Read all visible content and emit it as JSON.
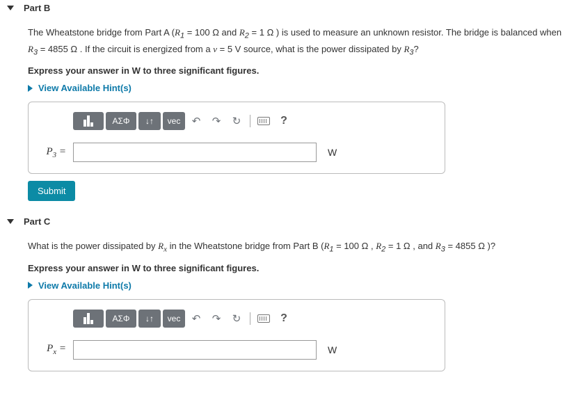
{
  "parts": {
    "b": {
      "title": "Part B",
      "prompt_html": "The Wheatstone bridge from Part A (<span class='ital'>R</span><span class='sub'>1</span> = 100  Ω and <span class='ital'>R</span><span class='sub'>2</span> = 1  Ω ) is used to measure an unknown resistor. The bridge is balanced when <span class='ital'>R</span><span class='sub'>3</span> = 4855  Ω . If the circuit is energized from a <span class='ital'>v</span> = 5  V  source, what is the power dissipated by <span class='ital'>R</span><span class='sub'>3</span>?",
      "instruction": "Express your answer in W to three significant figures.",
      "hint_label": "View Available Hint(s)",
      "var_html": "<span class='ital'>P</span><span class='sub'>3</span> =",
      "unit": "W",
      "submit": "Submit"
    },
    "c": {
      "title": "Part C",
      "prompt_html": "What is the power dissipated by <span class='ital'>R<span class='sub'>x</span></span> in the Wheatstone bridge from Part B (<span class='ital'>R</span><span class='sub'>1</span> = 100  Ω , <span class='ital'>R</span><span class='sub'>2</span> = 1  Ω , and <span class='ital'>R</span><span class='sub'>3</span> = 4855  Ω )?",
      "instruction": "Express your answer in W to three significant figures.",
      "hint_label": "View Available Hint(s)",
      "var_html": "<span class='ital'>P<span class='sub'>x</span></span> =",
      "unit": "W"
    }
  },
  "toolbar": {
    "greek": "ΑΣΦ",
    "subsup": "↓↑",
    "vec": "vec",
    "undo": "↶",
    "redo": "↷",
    "reset": "↻",
    "help": "?"
  }
}
